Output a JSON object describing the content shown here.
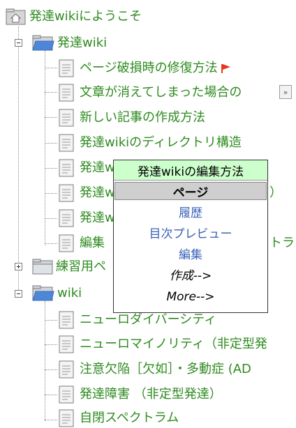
{
  "tree": {
    "root": {
      "label": "発達wikiにようこそ"
    },
    "folder_hattatsu": {
      "label": "発達wiki",
      "items": [
        "ページ破損時の修復方法",
        "文章が消えてしまった場合の",
        "新しい記事の作成方法",
        "発達wikiのディレクトリ構造",
        "発達w",
        "発達w",
        "発達w",
        "編集"
      ],
      "partials": [
        "）",
        "トラ"
      ]
    },
    "folder_practice": {
      "label": "練習用ペ"
    },
    "folder_wiki": {
      "label": "wiki",
      "items": [
        "ニューロダイバーシティ",
        "ニューロマイノリティ（非定型発",
        "注意欠陥［欠如］・多動症 (AD",
        "発達障害 （非定型発達）",
        "自閉スペクトラム"
      ]
    },
    "more_glyph": "»"
  },
  "popup": {
    "title": "発達wikiの編集方法",
    "header": "ページ",
    "links": [
      "履歴",
      "目次プレビュー",
      "編集"
    ],
    "actions": [
      "作成-->",
      "More-->"
    ]
  },
  "colors": {
    "link_green": "#2e8b1f",
    "link_blue": "#3a62b8",
    "popup_title_bg": "#ccffcc",
    "flag_red": "#e8361e"
  }
}
